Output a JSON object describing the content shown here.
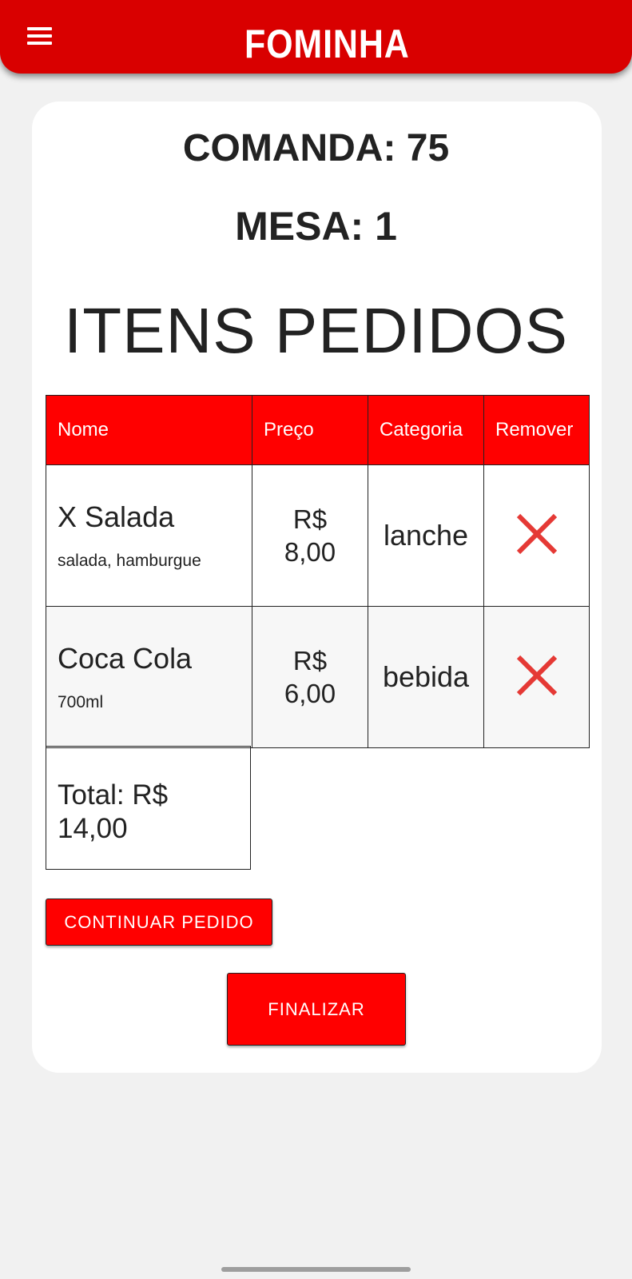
{
  "app": {
    "logo_text": "FOMINHA",
    "accent_color": "#d90000",
    "table_header_color": "#ff0000",
    "remove_icon_color": "#e53935"
  },
  "order": {
    "comanda": "COMANDA: 75",
    "mesa": "MESA: 1",
    "section_title": "ITENS PEDIDOS"
  },
  "table": {
    "headers": [
      "Nome",
      "Preço",
      "Categoria",
      "Remover"
    ],
    "rows": [
      {
        "name": "X Salada",
        "description": "salada, hamburgue",
        "price_currency": "R$",
        "price_value": "8,00",
        "category": "lanche",
        "remove_icon": "close-icon"
      },
      {
        "name": "Coca Cola",
        "description": "700ml",
        "price_currency": "R$",
        "price_value": "6,00",
        "category": "bebida",
        "remove_icon": "close-icon"
      }
    ]
  },
  "total": {
    "label_line1": "Total: R$",
    "label_line2": "14,00"
  },
  "buttons": {
    "continuar": "CONTINUAR PEDIDO",
    "finalizar": "FINALIZAR"
  }
}
